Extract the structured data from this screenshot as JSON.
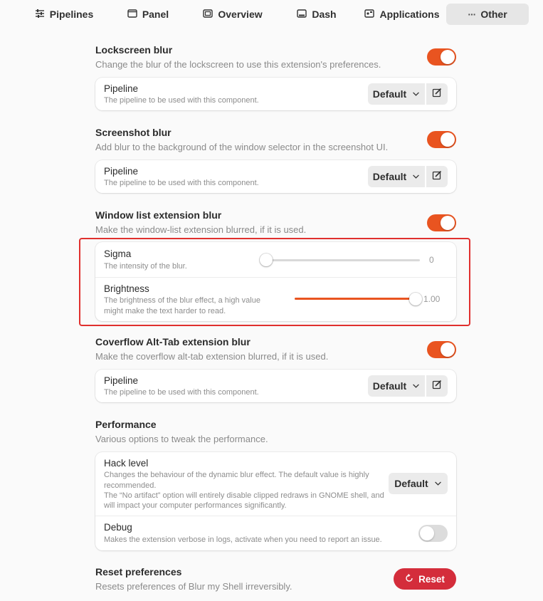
{
  "tabs": [
    {
      "label": "Pipelines",
      "icon": "sliders-icon"
    },
    {
      "label": "Panel",
      "icon": "panel-icon"
    },
    {
      "label": "Overview",
      "icon": "overview-icon"
    },
    {
      "label": "Dash",
      "icon": "dash-icon"
    },
    {
      "label": "Applications",
      "icon": "applications-icon"
    },
    {
      "label": "Other",
      "icon": "ellipsis-icon"
    }
  ],
  "lockscreen": {
    "title": "Lockscreen blur",
    "subtitle": "Change the blur of the lockscreen to use this extension's preferences.",
    "enabled": true,
    "pipeline_title": "Pipeline",
    "pipeline_sub": "The pipeline to be used with this component.",
    "pipeline_value": "Default"
  },
  "screenshot": {
    "title": "Screenshot blur",
    "subtitle": "Add blur to the background of the window selector in the screenshot UI.",
    "enabled": true,
    "pipeline_title": "Pipeline",
    "pipeline_sub": "The pipeline to be used with this component.",
    "pipeline_value": "Default"
  },
  "windowlist": {
    "title": "Window list extension blur",
    "subtitle": "Make the window-list extension blurred, if it is used.",
    "enabled": true,
    "sigma_title": "Sigma",
    "sigma_sub": "The intensity of the blur.",
    "sigma_value": "0",
    "brightness_title": "Brightness",
    "brightness_sub_1": "The brightness of the blur effect, a high value",
    "brightness_sub_2": "might make the text harder to read.",
    "brightness_value": "1.00"
  },
  "coverflow": {
    "title": "Coverflow Alt-Tab extension blur",
    "subtitle": "Make the coverflow alt-tab extension blurred, if it is used.",
    "enabled": true,
    "pipeline_title": "Pipeline",
    "pipeline_sub": "The pipeline to be used with this component.",
    "pipeline_value": "Default"
  },
  "performance": {
    "title": "Performance",
    "subtitle": "Various options to tweak the performance.",
    "hack_title": "Hack level",
    "hack_sub_1": "Changes the behaviour of the dynamic blur effect. The default value is highly",
    "hack_sub_2": "recommended.",
    "hack_sub_3": "The “No artifact” option will entirely disable clipped redraws in GNOME shell, and",
    "hack_sub_4": "will impact your computer performances significantly.",
    "hack_value": "Default",
    "debug_title": "Debug",
    "debug_sub": "Makes the extension verbose in logs, activate when you need to report an issue.",
    "debug_enabled": false
  },
  "reset": {
    "title": "Reset preferences",
    "subtitle": "Resets preferences of Blur my Shell irreversibly.",
    "button_label": "Reset"
  },
  "colors": {
    "accent": "#e95420",
    "destructive": "#d42d3b",
    "highlight": "#e0302e"
  }
}
